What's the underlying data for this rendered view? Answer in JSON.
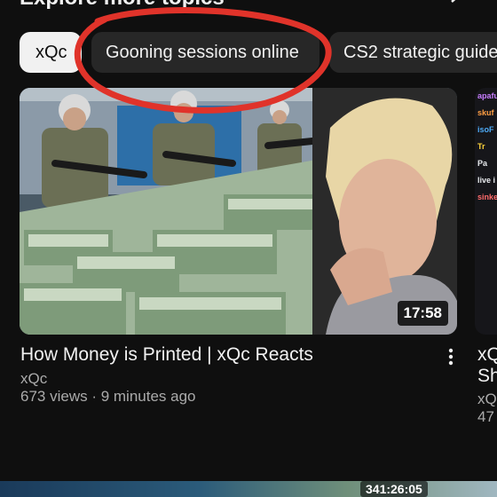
{
  "header": {
    "heading": "Explore more topics"
  },
  "chips": [
    {
      "label": "xQc",
      "selected": true
    },
    {
      "label": "Gooning sessions online",
      "selected": false
    },
    {
      "label": "CS2 strategic guide",
      "selected": false
    }
  ],
  "video": {
    "duration": "17:58",
    "title": "How Money is Printed | xQc Reacts",
    "channel": "xQc",
    "meta": "673 views · 9 minutes ago"
  },
  "next_video": {
    "chat": [
      "apafu",
      "skuf",
      "isoF",
      "Tr",
      "Pa",
      "live i",
      "sinke"
    ],
    "title_lines": [
      "xQ",
      "Sh"
    ],
    "channel": "xQ",
    "meta": "47"
  },
  "bottom": {
    "time": "341:26:05"
  },
  "colors": {
    "background": "#0f0f0f",
    "chip": "#272727",
    "annotation": "#e0332a"
  }
}
